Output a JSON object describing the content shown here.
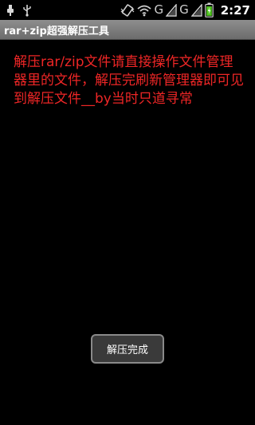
{
  "status_bar": {
    "time": "2:27",
    "network_1": "G",
    "network_2": "G",
    "icons": [
      "usb-icon",
      "usb-debug-icon",
      "vibrate-icon",
      "wifi-icon",
      "signal-icon",
      "signal-icon",
      "battery-icon"
    ]
  },
  "app": {
    "title": "rar+zip超强解压工具"
  },
  "main": {
    "message": "解压rar/zip文件请直接操作文件管理器里的文件，解压完刷新管理器即可见到解压文件__by当时只道寻常",
    "message_color": "#ee2626"
  },
  "toast": {
    "text": "解压完成"
  }
}
